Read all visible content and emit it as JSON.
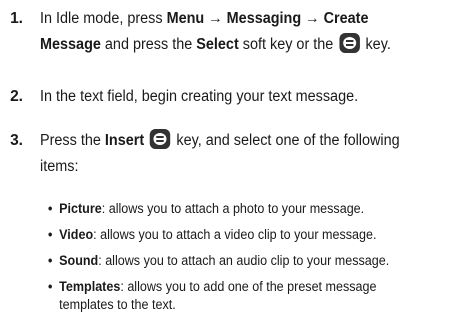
{
  "steps": [
    {
      "number": "1.",
      "line1": {
        "t1": "In Idle mode, press ",
        "b1": "Menu",
        "arrow1": " → ",
        "b2": "Messaging",
        "arrow2": " → ",
        "b3": "Create"
      },
      "line2": {
        "b1": "Message",
        "t1": " and press the ",
        "b2": "Select",
        "t2": " soft key or the ",
        "t3": " key."
      }
    },
    {
      "number": "2.",
      "line1": {
        "t1": "In the text field, begin creating your text message."
      }
    },
    {
      "number": "3.",
      "line1": {
        "t1": "Press the ",
        "b1": "Insert",
        "t2": " key, and select one of the following"
      },
      "line2": {
        "t1": "items:"
      }
    }
  ],
  "options": [
    {
      "name": "Picture",
      "desc": ": allows you to attach a photo to your message."
    },
    {
      "name": "Video",
      "desc": ": allows you to attach a video clip to your message."
    },
    {
      "name": "Sound",
      "desc": ": allows you to attach an audio clip to your message."
    },
    {
      "name": "Templates",
      "desc": ": allows you to add one of the preset message",
      "desc2": "templates to the text."
    }
  ],
  "icons": {
    "select_key": "select-key-icon",
    "insert_key": "insert-key-icon"
  },
  "colors": {
    "text": "#1a1a1a",
    "key": "#333333"
  }
}
